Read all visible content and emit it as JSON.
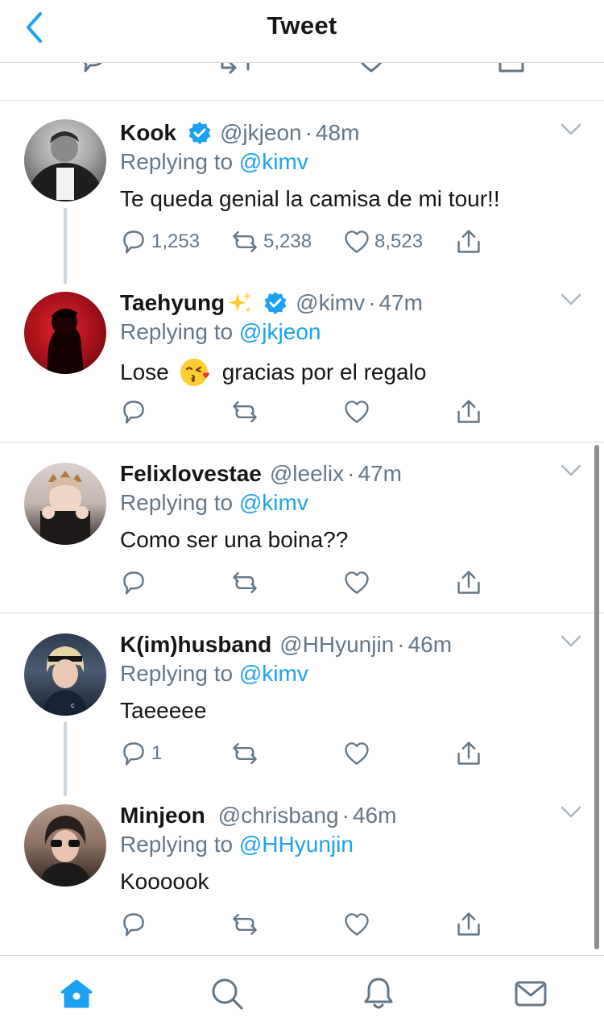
{
  "header": {
    "title": "Tweet",
    "back_icon": "chevron-left-icon",
    "accent": "#1da1f2"
  },
  "tweets": [
    {
      "name": "Kook",
      "verified": true,
      "sparkles": false,
      "handle": "@jkjeon",
      "time": "48m",
      "reply_prefix": "Replying to",
      "reply_to": "@kimv",
      "text": "Te queda genial la camisa de mi tour!!",
      "replies": "1,253",
      "retweets": "5,238",
      "likes": "8,523"
    },
    {
      "name": "Taehyung",
      "verified": true,
      "sparkles": true,
      "handle": "@kimv",
      "time": "47m",
      "reply_prefix": "Replying to",
      "reply_to": "@jkjeon",
      "text_before": "Lose",
      "emoji": "kissing-face-emoji",
      "text_after": "gracias por el regalo",
      "replies": "",
      "retweets": "",
      "likes": ""
    },
    {
      "name": "Felixlovestae",
      "verified": false,
      "sparkles": false,
      "handle": "@leelix",
      "time": "47m",
      "reply_prefix": "Replying to",
      "reply_to": "@kimv",
      "text": "Como ser una boina??",
      "replies": "",
      "retweets": "",
      "likes": ""
    },
    {
      "name": "K(im)husband",
      "verified": false,
      "sparkles": false,
      "handle": "@HHyunjin",
      "time": "46m",
      "reply_prefix": "Replying to",
      "reply_to": "@kimv",
      "text": "Taeeeee",
      "replies": "1",
      "retweets": "",
      "likes": ""
    },
    {
      "name": "Minjeon",
      "verified": false,
      "sparkles": false,
      "handle": "@chrisbang",
      "time": "46m",
      "reply_prefix": "Replying to",
      "reply_to": "@HHyunjin",
      "text": "Koooook",
      "replies": "",
      "retweets": "",
      "likes": ""
    }
  ],
  "time_separator": "·",
  "tabbar": {
    "items": [
      "home-icon",
      "search-icon",
      "bell-icon",
      "mail-icon"
    ],
    "active": "home-icon"
  },
  "colors": {
    "text": "#14171a",
    "secondary": "#657786",
    "link": "#1da1f2",
    "divider": "#d7dde3",
    "thread_line": "#ccd6dd"
  }
}
